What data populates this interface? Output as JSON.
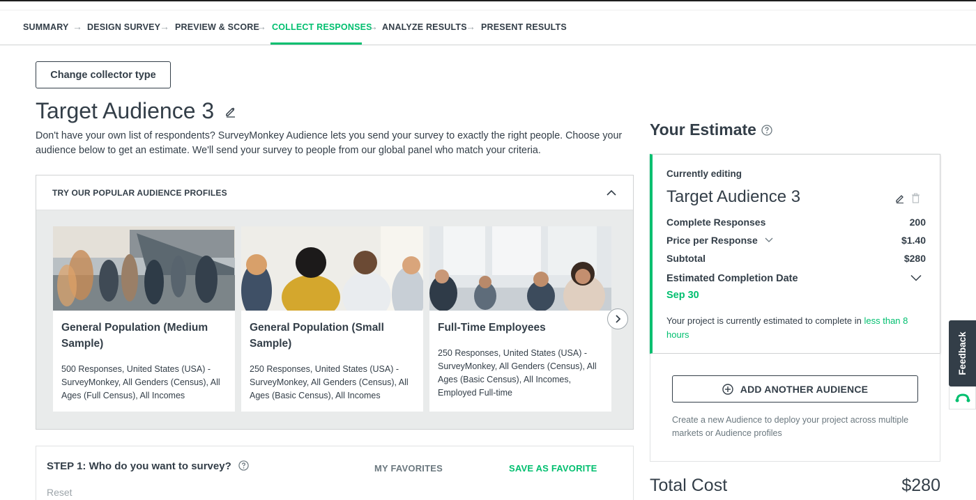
{
  "nav": {
    "steps": [
      {
        "label": "SUMMARY"
      },
      {
        "label": "DESIGN SURVEY"
      },
      {
        "label": "PREVIEW & SCORE"
      },
      {
        "label": "COLLECT RESPONSES",
        "active": true
      },
      {
        "label": "ANALYZE RESULTS"
      },
      {
        "label": "PRESENT RESULTS"
      }
    ],
    "arrow": "→"
  },
  "collector": {
    "change_button": "Change collector type",
    "title": "Target Audience 3",
    "intro": "Don't have your own list of respondents? SurveyMonkey Audience lets you send your survey to exactly the right people. Choose your audience below to get an estimate. We'll send your survey to people from our global panel who match your criteria."
  },
  "profiles": {
    "header": "TRY OUR POPULAR AUDIENCE PROFILES",
    "cards": [
      {
        "title": "General Population (Medium Sample)",
        "description": "500 Responses, United States (USA) - SurveyMonkey, All Genders (Census), All Ages (Full Census), All Incomes"
      },
      {
        "title": "General Population (Small Sample)",
        "description": "250 Responses, United States (USA) - SurveyMonkey, All Genders (Census), All Ages (Basic Census), All Incomes"
      },
      {
        "title": "Full-Time Employees",
        "description": "250 Responses, United States (USA) - SurveyMonkey, All Genders (Census), All Ages (Basic Census), All Incomes, Employed Full-time"
      }
    ]
  },
  "step1": {
    "title": "STEP 1: Who do you want to survey?",
    "my_favorites": "MY FAVORITES",
    "save_favorite": "SAVE AS FAVORITE",
    "reset": "Reset"
  },
  "estimate": {
    "title": "Your Estimate",
    "currently_editing": "Currently editing",
    "audience_name": "Target Audience 3",
    "complete_responses_label": "Complete Responses",
    "complete_responses_value": "200",
    "price_label": "Price per Response",
    "price_value": "$1.40",
    "subtotal_label": "Subtotal",
    "subtotal_value": "$280",
    "completion_label": "Estimated Completion Date",
    "completion_date": "Sep 30",
    "note_prefix": "Your project is currently estimated to complete in ",
    "note_highlight": "less than 8 hours",
    "add_audience_button": "ADD ANOTHER AUDIENCE",
    "add_audience_note": "Create a new Audience to deploy your project across multiple markets or Audience profiles",
    "total_label": "Total Cost",
    "total_value": "$280"
  },
  "feedback": {
    "label": "Feedback"
  },
  "colors": {
    "accent": "#00bf6f",
    "text": "#333e48",
    "muted": "#6b787f",
    "panel_bg": "#e9ebeb"
  }
}
